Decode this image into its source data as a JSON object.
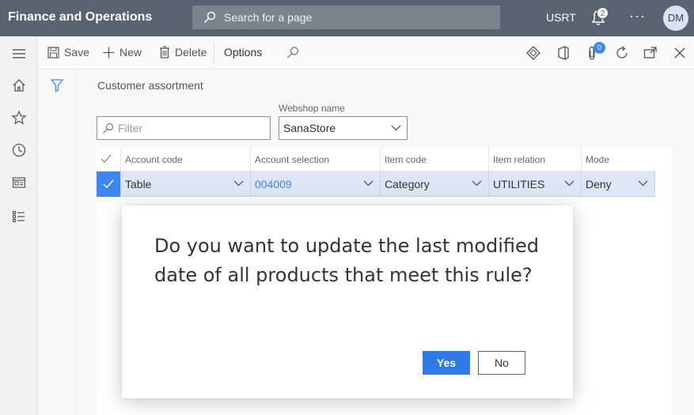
{
  "app": {
    "title": "Finance and Operations"
  },
  "search": {
    "placeholder": "Search for a page"
  },
  "header": {
    "company": "USRT",
    "notifications_count": "2",
    "more": "···",
    "user_initials": "DM"
  },
  "actionbar": {
    "save": "Save",
    "new": "New",
    "delete": "Delete",
    "options": "Options",
    "attachments_count": "0"
  },
  "page": {
    "caption": "Customer assortment",
    "filter_placeholder": "Filter",
    "webshop_label": "Webshop name",
    "webshop_value": "SanaStore"
  },
  "grid": {
    "columns": [
      "Account code",
      "Account selection",
      "Item code",
      "Item relation",
      "Mode"
    ],
    "rows": [
      {
        "account_code": "Table",
        "account_selection": "004009",
        "item_code": "Category",
        "item_relation": "UTILITIES",
        "mode": "Deny"
      }
    ]
  },
  "dialog": {
    "message": "Do you want to update the last modified date of all products that meet this rule?",
    "yes": "Yes",
    "no": "No"
  },
  "colors": {
    "topbar": "#5a6370",
    "accent": "#3f86f3",
    "primary_button": "#2f7ae5"
  }
}
